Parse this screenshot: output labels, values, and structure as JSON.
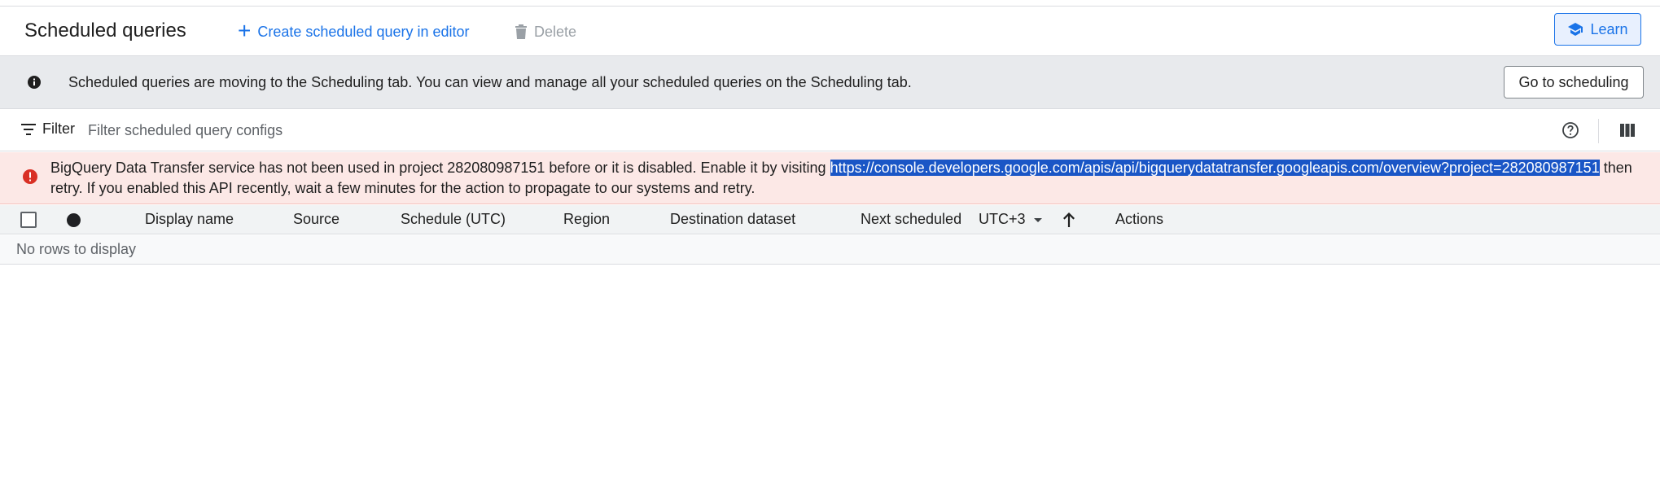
{
  "header": {
    "title": "Scheduled queries",
    "create_label": "Create scheduled query in editor",
    "delete_label": "Delete",
    "learn_label": "Learn"
  },
  "info_banner": {
    "message": "Scheduled queries are moving to the Scheduling tab. You can view and manage all your scheduled queries on the Scheduling tab.",
    "button_label": "Go to scheduling"
  },
  "filter": {
    "label": "Filter",
    "placeholder": "Filter scheduled query configs"
  },
  "error_banner": {
    "text_before": "BigQuery Data Transfer service has not been used in project 282080987151 before or it is disabled. Enable it by visiting ",
    "link": "https://console.developers.google.com/apis/api/bigquerydatatransfer.googleapis.com/overview?project=282080987151",
    "text_after": " then retry. If you enabled this API recently, wait a few minutes for the action to propagate to our systems and retry."
  },
  "table": {
    "columns": {
      "display_name": "Display name",
      "source": "Source",
      "schedule": "Schedule (UTC)",
      "region": "Region",
      "destination": "Destination dataset",
      "next_scheduled": "Next scheduled",
      "timezone": "UTC+3",
      "actions": "Actions"
    },
    "empty_message": "No rows to display"
  },
  "colors": {
    "accent": "#1a73e8",
    "error_bg": "#fce8e6",
    "info_bg": "#e8eaed",
    "error_icon": "#d93025"
  },
  "icons": [
    "plus-icon",
    "trash-icon",
    "school-icon",
    "info-icon",
    "filter-icon",
    "help-icon",
    "columns-icon",
    "error-icon",
    "arrow-up-icon"
  ]
}
